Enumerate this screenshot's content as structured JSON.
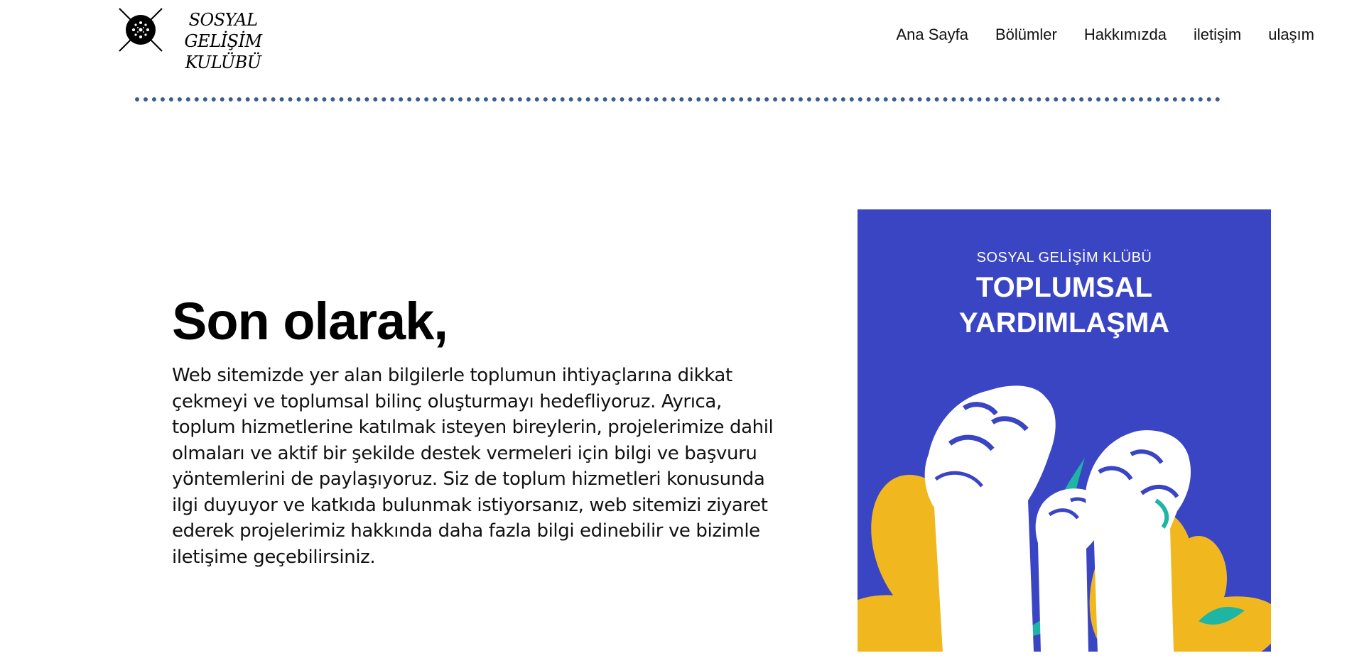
{
  "logo": {
    "line1": "SOSYAL GELİŞİM",
    "line2": "KULÜBÜ",
    "icon": "club-emblem-icon"
  },
  "nav": {
    "items": [
      {
        "label": "Ana Sayfa"
      },
      {
        "label": "Bölümler"
      },
      {
        "label": "Hakkımızda"
      },
      {
        "label": "iletişim"
      },
      {
        "label": "ulaşım"
      }
    ]
  },
  "main": {
    "heading": "Son olarak,",
    "paragraph": "Web sitemizde yer alan bilgilerle toplumun ihtiyaçlarına dikkat çekmeyi ve toplumsal bilinç oluşturmayı hedefliyoruz. Ayrıca, toplum hizmetlerine katılmak isteyen bireylerin, projelerimize dahil olmaları ve aktif bir şekilde destek vermeleri için bilgi ve başvuru yöntemlerini de paylaşıyoruz. Siz de toplum hizmetleri konusunda ilgi duyuyor ve katkıda bulunmak istiyorsanız, web sitemizi ziyaret ederek projelerimiz hakkında daha fazla bilgi edinebilir ve bizimle iletişime geçebilirsiniz."
  },
  "poster": {
    "subtitle": "SOSYAL GELİŞİM KLÜBÜ",
    "title_line1": "TOPLUMSAL",
    "title_line2": "YARDIMLAŞMA",
    "colors": {
      "background": "#3a45c4",
      "flower": "#f0b81e",
      "leaf": "#1fb5a4",
      "fist": "#ffffff"
    }
  },
  "colors": {
    "divider": "#3b5d8f"
  }
}
